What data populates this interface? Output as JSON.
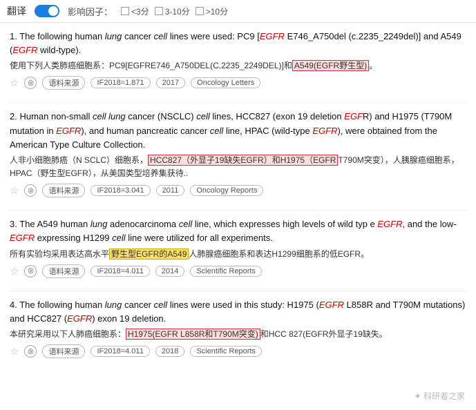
{
  "topbar": {
    "translate_label": "翻译",
    "toggle_state": "on",
    "factor_label": "影响因子：",
    "factors": [
      {
        "label": "<3分",
        "checked": false
      },
      {
        "label": "3-10分",
        "checked": false
      },
      {
        "label": ">10分",
        "checked": false
      }
    ]
  },
  "results": [
    {
      "number": "1.",
      "english": "The following human lung cancer cell lines were used: PC9 [EGFR E746_A750del (c.2235_2249del)] and A549 (EGFR wild-type).",
      "chinese": "使用下列人类肺癌细胞系：PC9[EGFRE746_A750DEL(C.2235_2249DEL)]和A549(EGFR野生型)。",
      "chinese_highlight_1": "A549(EGFR野生型)",
      "actions": {
        "star": "☆",
        "source_label": "语料来源",
        "if_label": "IF2018=1.871",
        "year_label": "2017",
        "journal_label": "Oncology Letters"
      }
    },
    {
      "number": "2.",
      "english": "Human non-small cell lung cancer (NSCLC) cell lines, HCC827 (exon 19 deletion EGFR) and H1975 (T790M mutation in EGFR), and human pancreatic cancer cell line, HPAC (wild-type EGFR), were obtained from the American Type Culture Collection.",
      "chinese": "人非小细胞肺癌（N SCLC）细胞系，HCC827（外显子19缺失EGFR）和H1975（EGFR T790M突变），人胰腺癌细胞系，HPAC（野生型EGFR），从美国类型培养集获待..",
      "chinese_highlight_1": "HCC827（外显子19缺失EGFR）和H1975（EGFR",
      "actions": {
        "star": "☆",
        "source_label": "语料来源",
        "if_label": "IF2018=3.041",
        "year_label": "2011",
        "journal_label": "Oncology Reports"
      }
    },
    {
      "number": "3.",
      "english": "The A549 human lung adenocarcinoma cell line, which expresses high levels of wild type EGFR, and the low-EGFR expressing H1299 cell line were utilized for all experiments.",
      "chinese": "所有实验均采用表达高水平野生型EGFR的A549人肺腺癌细胞系和表达H1299细胞系的低EGFR。",
      "chinese_highlight_1": "野生型EGFR的A549",
      "actions": {
        "star": "☆",
        "source_label": "语料来源",
        "if_label": "IF2018=4.011",
        "year_label": "2014",
        "journal_label": "Scientific Reports"
      }
    },
    {
      "number": "4.",
      "english": "The following human lung cancer cell lines were used in this study: H1975 (EGFR L858R and T790M mutations) and HCC827 (EGFR exon 19 deletion.",
      "chinese": "本研究采用以下人肺癌细胞系：H1975(EGFR L858R和T790M突变)和HCC 827(EGFR外显子19缺失。",
      "chinese_highlight_1": "H1975(EGFR L858R和T790M突变)",
      "actions": {
        "star": "☆",
        "source_label": "语料来源",
        "if_label": "IF2018=4.011",
        "year_label": "2018",
        "journal_label": "Scientific Reports"
      }
    }
  ],
  "watermark": "科研者之家"
}
